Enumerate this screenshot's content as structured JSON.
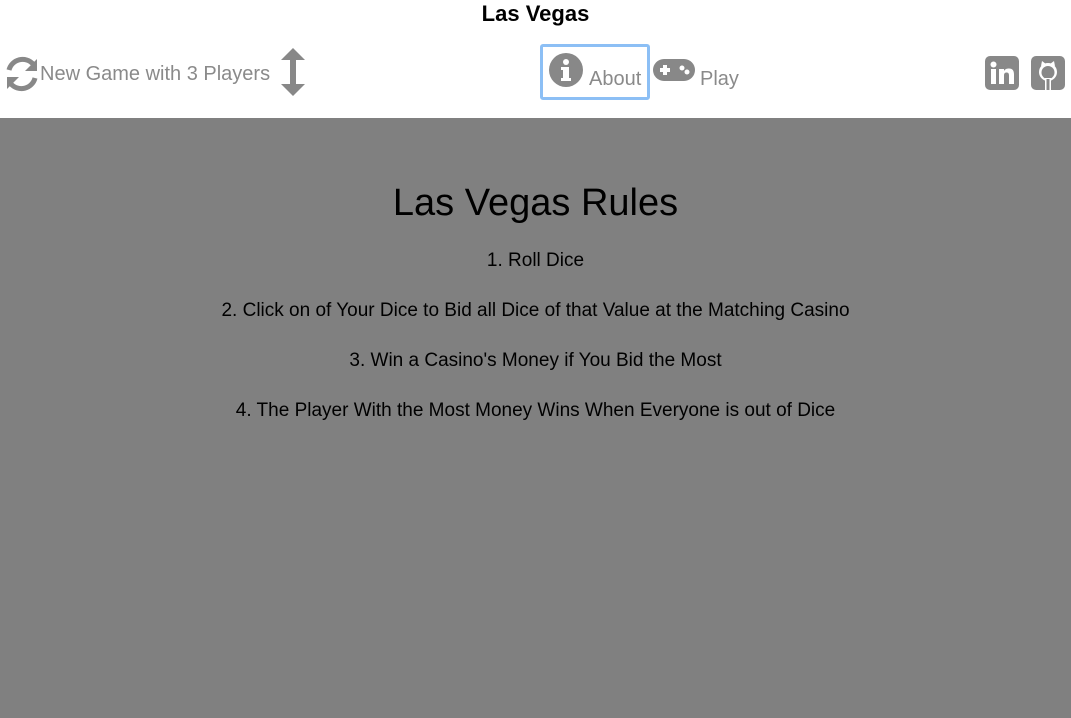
{
  "header": {
    "title": "Las Vegas"
  },
  "toolbar": {
    "new_game_label": "New Game with 3 Players",
    "about_label": "About",
    "play_label": "Play"
  },
  "icons": {
    "new_game": "refresh-icon",
    "players": "up-down-arrows-icon",
    "about": "info-circle-icon",
    "play": "gamepad-icon",
    "linkedin": "linkedin-icon",
    "github": "github-icon"
  },
  "colors": {
    "icon_gray": "#888888",
    "focus_ring": "#8cbff5",
    "content_bg": "#808080"
  },
  "rules": {
    "title": "Las Vegas Rules",
    "items": [
      "1. Roll Dice",
      "2. Click on of Your Dice to Bid all Dice of that Value at the Matching Casino",
      "3. Win a Casino's Money if You Bid the Most",
      "4. The Player With the Most Money Wins When Everyone is out of Dice"
    ]
  }
}
